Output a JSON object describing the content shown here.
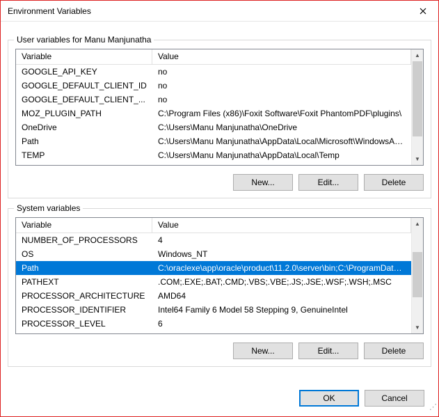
{
  "window": {
    "title": "Environment Variables"
  },
  "userGroup": {
    "label": "User variables for Manu Manjunatha",
    "columns": {
      "var": "Variable",
      "val": "Value"
    },
    "rows": [
      {
        "var": "GOOGLE_API_KEY",
        "val": "no"
      },
      {
        "var": "GOOGLE_DEFAULT_CLIENT_ID",
        "val": "no"
      },
      {
        "var": "GOOGLE_DEFAULT_CLIENT_...",
        "val": "no"
      },
      {
        "var": "MOZ_PLUGIN_PATH",
        "val": "C:\\Program Files (x86)\\Foxit Software\\Foxit PhantomPDF\\plugins\\"
      },
      {
        "var": "OneDrive",
        "val": "C:\\Users\\Manu Manjunatha\\OneDrive"
      },
      {
        "var": "Path",
        "val": "C:\\Users\\Manu Manjunatha\\AppData\\Local\\Microsoft\\WindowsAp..."
      },
      {
        "var": "TEMP",
        "val": "C:\\Users\\Manu Manjunatha\\AppData\\Local\\Temp"
      }
    ],
    "buttons": {
      "new": "New...",
      "edit": "Edit...",
      "delete": "Delete"
    }
  },
  "systemGroup": {
    "label": "System variables",
    "columns": {
      "var": "Variable",
      "val": "Value"
    },
    "rows": [
      {
        "var": "NUMBER_OF_PROCESSORS",
        "val": "4"
      },
      {
        "var": "OS",
        "val": "Windows_NT"
      },
      {
        "var": "Path",
        "val": "C:\\oraclexe\\app\\oracle\\product\\11.2.0\\server\\bin;C:\\ProgramData\\...",
        "selected": true
      },
      {
        "var": "PATHEXT",
        "val": ".COM;.EXE;.BAT;.CMD;.VBS;.VBE;.JS;.JSE;.WSF;.WSH;.MSC"
      },
      {
        "var": "PROCESSOR_ARCHITECTURE",
        "val": "AMD64"
      },
      {
        "var": "PROCESSOR_IDENTIFIER",
        "val": "Intel64 Family 6 Model 58 Stepping 9, GenuineIntel"
      },
      {
        "var": "PROCESSOR_LEVEL",
        "val": "6"
      }
    ],
    "buttons": {
      "new": "New...",
      "edit": "Edit...",
      "delete": "Delete"
    }
  },
  "dialogButtons": {
    "ok": "OK",
    "cancel": "Cancel"
  }
}
